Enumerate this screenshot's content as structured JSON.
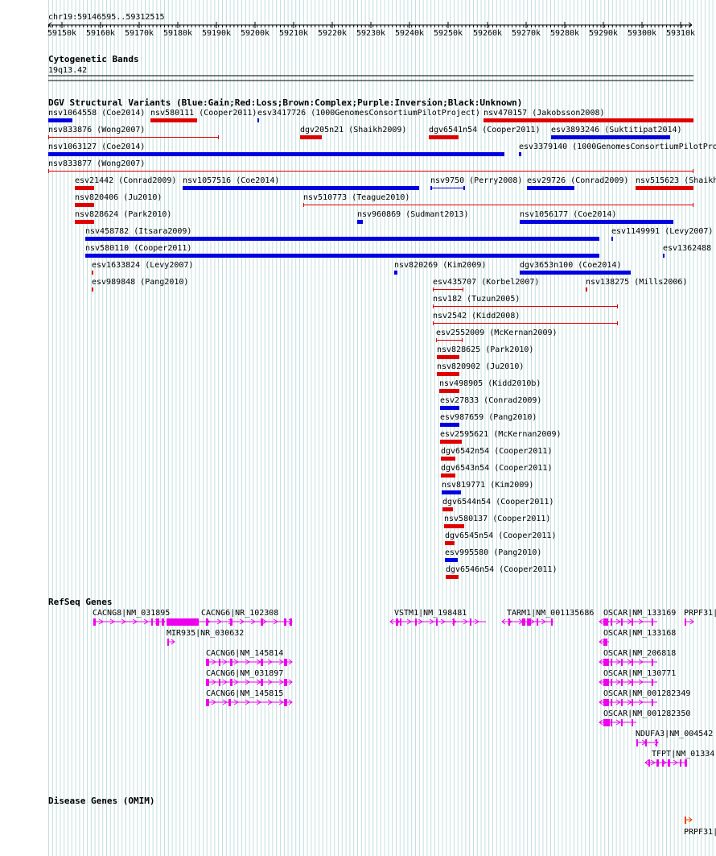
{
  "ruler": {
    "position": "chr19:59146595..59312515",
    "ticks": [
      "59150k",
      "59160k",
      "59170k",
      "59180k",
      "59190k",
      "59200k",
      "59210k",
      "59220k",
      "59230k",
      "59240k",
      "59250k",
      "59260k",
      "59270k",
      "59280k",
      "59290k",
      "59300k",
      "59310k"
    ]
  },
  "tracks": {
    "cytoband": {
      "title": "Cytogenetic Bands",
      "band": "19q13.42"
    },
    "dgv": {
      "title": "DGV Structural Variants (Blue:Gain;Red:Loss;Brown:Complex;Purple:Inversion;Black:Unknown)",
      "colors": {
        "gain": "#0000e0",
        "loss": "#e00000"
      },
      "items": [
        {
          "label": "nsv1064558 (Coe2014)",
          "type": "gain"
        },
        {
          "label": "nsv580111 (Cooper2011)",
          "type": "loss"
        },
        {
          "label": "esv3417726 (1000GenomesConsortiumPilotProject)",
          "type": "gain"
        },
        {
          "label": "nsv470157 (Jakobsson2008)",
          "type": "loss"
        },
        {
          "label": "nsv833876 (Wong2007)",
          "type": "loss"
        },
        {
          "label": "dgv205n21 (Shaikh2009)",
          "type": "loss"
        },
        {
          "label": "dgv6541n54 (Cooper2011)",
          "type": "loss"
        },
        {
          "label": "esv3893246 (Suktitipat2014)",
          "type": "gain"
        },
        {
          "label": "nsv1063127 (Coe2014)",
          "type": "gain"
        },
        {
          "label": "esv3379140 (1000GenomesConsortiumPilotPro",
          "type": "gain"
        },
        {
          "label": "nsv833877 (Wong2007)",
          "type": "loss"
        },
        {
          "label": "esv21442 (Conrad2009)",
          "type": "loss"
        },
        {
          "label": "nsv1057516 (Coe2014)",
          "type": "gain"
        },
        {
          "label": "nsv9750 (Perry2008)",
          "type": "gain"
        },
        {
          "label": "esv29726 (Conrad2009)",
          "type": "gain"
        },
        {
          "label": "nsv515623 (Shaikh",
          "type": "loss"
        },
        {
          "label": "nsv820406 (Ju2010)",
          "type": "loss"
        },
        {
          "label": "nsv510773 (Teague2010)",
          "type": "loss"
        },
        {
          "label": "nsv828624 (Park2010)",
          "type": "loss"
        },
        {
          "label": "nsv960869 (Sudmant2013)",
          "type": "gain"
        },
        {
          "label": "nsv1056177 (Coe2014)",
          "type": "gain"
        },
        {
          "label": "nsv458782 (Itsara2009)",
          "type": "gain"
        },
        {
          "label": "esv1149991 (Levy2007)",
          "type": "gain"
        },
        {
          "label": "nsv580110 (Cooper2011)",
          "type": "gain"
        },
        {
          "label": "esv1362488",
          "type": "gain"
        },
        {
          "label": "esv1633824 (Levy2007)",
          "type": "loss"
        },
        {
          "label": "nsv820269 (Kim2009)",
          "type": "gain"
        },
        {
          "label": "dgv3653n100 (Coe2014)",
          "type": "gain"
        },
        {
          "label": "esv989848 (Pang2010)",
          "type": "loss"
        },
        {
          "label": "esv435707 (Korbel2007)",
          "type": "loss"
        },
        {
          "label": "nsv138275 (Mills2006)",
          "type": "loss"
        },
        {
          "label": "nsv182 (Tuzun2005)",
          "type": "loss"
        },
        {
          "label": "nsv2542 (Kidd2008)",
          "type": "loss"
        },
        {
          "label": "esv2552009 (McKernan2009)",
          "type": "loss"
        },
        {
          "label": "nsv828625 (Park2010)",
          "type": "loss"
        },
        {
          "label": "nsv820902 (Ju2010)",
          "type": "loss"
        },
        {
          "label": "nsv498905 (Kidd2010b)",
          "type": "loss"
        },
        {
          "label": "esv27833 (Conrad2009)",
          "type": "gain"
        },
        {
          "label": "esv987659 (Pang2010)",
          "type": "gain"
        },
        {
          "label": "esv2595621 (McKernan2009)",
          "type": "loss"
        },
        {
          "label": "dgv6542n54 (Cooper2011)",
          "type": "loss"
        },
        {
          "label": "dgv6543n54 (Cooper2011)",
          "type": "loss"
        },
        {
          "label": "nsv819771 (Kim2009)",
          "type": "gain"
        },
        {
          "label": "dgv6544n54 (Cooper2011)",
          "type": "loss"
        },
        {
          "label": "nsv580137 (Cooper2011)",
          "type": "loss"
        },
        {
          "label": "dgv6545n54 (Cooper2011)",
          "type": "loss"
        },
        {
          "label": "esv995580 (Pang2010)",
          "type": "gain"
        },
        {
          "label": "dgv6546n54 (Cooper2011)",
          "type": "loss"
        }
      ]
    },
    "refseq": {
      "title": "RefSeq Genes",
      "color": "#ee00ee",
      "items": [
        {
          "label": "CACNG8|NM_031895"
        },
        {
          "label": "CACNG6|NR_102308"
        },
        {
          "label": "MIR935|NR_030632"
        },
        {
          "label": "CACNG6|NM_145814"
        },
        {
          "label": "CACNG6|NM_031897"
        },
        {
          "label": "CACNG6|NM_145815"
        },
        {
          "label": "VSTM1|NM_198481"
        },
        {
          "label": "TARM1|NM_001135686"
        },
        {
          "label": "OSCAR|NM_133169"
        },
        {
          "label": "OSCAR|NM_133168"
        },
        {
          "label": "OSCAR|NM_206818"
        },
        {
          "label": "OSCAR|NM_130771"
        },
        {
          "label": "OSCAR|NM_001282349"
        },
        {
          "label": "OSCAR|NM_001282350"
        },
        {
          "label": "NDUFA3|NM_004542"
        },
        {
          "label": "TFPT|NM_01334"
        },
        {
          "label": "PRPF31|"
        }
      ]
    },
    "omim": {
      "title": "Disease Genes (OMIM)",
      "color": "#ee4400",
      "items": [
        {
          "label": "PRPF31|"
        }
      ]
    }
  }
}
